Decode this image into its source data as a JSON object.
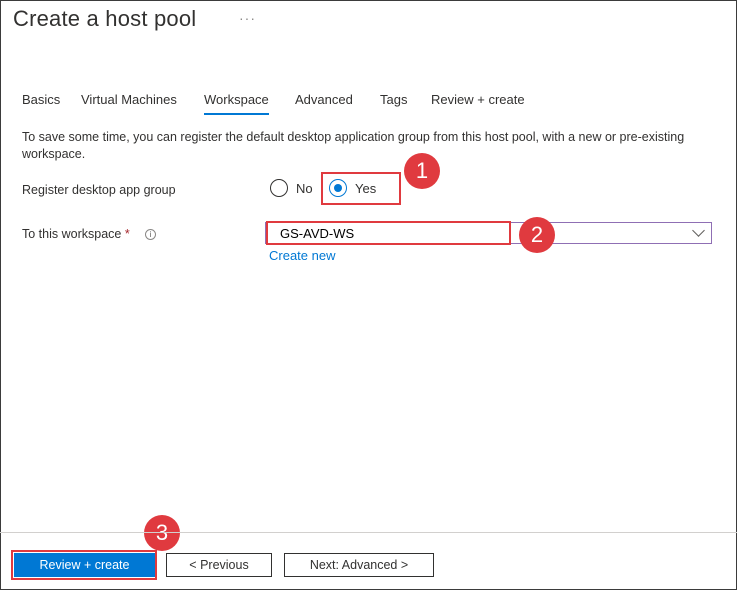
{
  "header": {
    "title": "Create a host pool",
    "more": "···"
  },
  "tabs": [
    {
      "label": "Basics"
    },
    {
      "label": "Virtual Machines"
    },
    {
      "label": "Workspace"
    },
    {
      "label": "Advanced"
    },
    {
      "label": "Tags"
    },
    {
      "label": "Review + create"
    }
  ],
  "active_tab": "Workspace",
  "description": "To save some time, you can register the default desktop application group from this host pool, with a new or pre-existing workspace.",
  "register_group": {
    "label": "Register desktop app group",
    "options": [
      {
        "label": "No"
      },
      {
        "label": "Yes"
      }
    ],
    "selected": "Yes"
  },
  "workspace": {
    "label": "To this workspace",
    "required_mark": "*",
    "info_icon_glyph": "i",
    "value": "GS-AVD-WS",
    "create_new": "Create new"
  },
  "callouts": [
    "1",
    "2",
    "3"
  ],
  "footer": {
    "review_create": "Review + create",
    "previous": "< Previous",
    "next": "Next: Advanced >"
  },
  "colors": {
    "accent": "#0078d4",
    "highlight": "#e03a3f",
    "select_border": "#8f6fb4"
  },
  "icons": {
    "info": "info-icon",
    "chevron": "chevron-down-icon",
    "more": "more-icon"
  }
}
